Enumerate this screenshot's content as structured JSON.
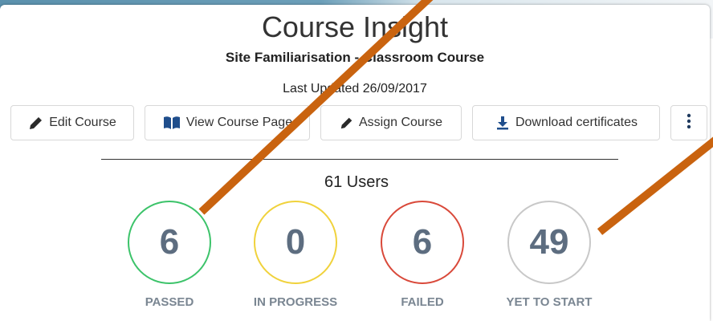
{
  "header": {
    "title": "Course Insight",
    "subtitle": "Site Familiarisation - Classroom Course",
    "last_updated": "Last Updated 26/09/2017"
  },
  "toolbar": {
    "edit_label": "Edit Course",
    "view_label": "View Course Page",
    "assign_label": "Assign Course",
    "download_label": "Download certificates"
  },
  "summary": {
    "users_label": "61 Users"
  },
  "stats": [
    {
      "value": "6",
      "label": "PASSED",
      "color": "#3cc36a"
    },
    {
      "value": "0",
      "label": "IN PROGRESS",
      "color": "#f0d23c"
    },
    {
      "value": "6",
      "label": "FAILED",
      "color": "#d9493a"
    },
    {
      "value": "49",
      "label": "YET TO START",
      "color": "#c8c8c8"
    }
  ],
  "colors": {
    "brand_bar": "#5b91ad",
    "annotation_arrow": "#c9630f",
    "stat_number": "#5d6d80",
    "stat_label": "#7a8692"
  },
  "icons": {
    "edit": "pencil-icon",
    "view": "book-icon",
    "assign": "pencil-icon",
    "download": "download-icon",
    "more": "more-vertical-icon"
  }
}
